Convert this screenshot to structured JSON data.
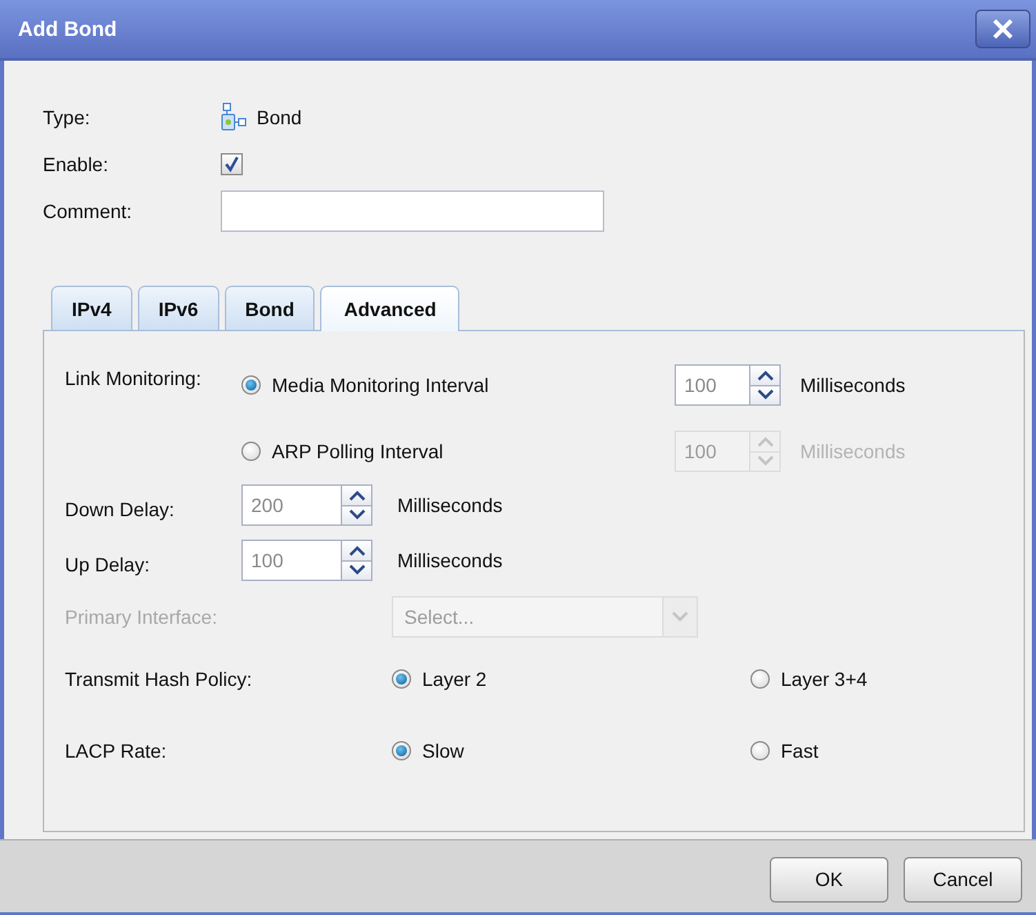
{
  "window": {
    "title": "Add Bond"
  },
  "fields": {
    "type": {
      "label": "Type:",
      "value": "Bond"
    },
    "enable": {
      "label": "Enable:",
      "checked": true
    },
    "comment": {
      "label": "Comment:"
    }
  },
  "tabs": [
    {
      "label": "IPv4",
      "selected": false
    },
    {
      "label": "IPv6",
      "selected": false
    },
    {
      "label": "Bond",
      "selected": false
    },
    {
      "label": "Advanced",
      "selected": true
    }
  ],
  "link_monitoring": {
    "label": "Link Monitoring:",
    "options": [
      {
        "label": "Media Monitoring Interval",
        "selected": true,
        "spinner": {
          "placeholder": "100",
          "disabled": false
        },
        "unit": "Milliseconds"
      },
      {
        "label": "ARP Polling Interval",
        "selected": false,
        "spinner": {
          "placeholder": "100",
          "disabled": true
        },
        "unit": "Milliseconds"
      }
    ]
  },
  "delays": [
    {
      "label": "Down Delay:",
      "placeholder": "200",
      "unit": "Milliseconds"
    },
    {
      "label": "Up Delay:",
      "placeholder": "100",
      "unit": "Milliseconds"
    }
  ],
  "primary_interface": {
    "label": "Primary Interface:",
    "placeholder": "Select...",
    "disabled": true
  },
  "choices": [
    {
      "label": "Transmit Hash Policy:",
      "options": [
        {
          "label": "Layer 2",
          "selected": true
        },
        {
          "label": "Layer 3+4",
          "selected": false
        }
      ]
    },
    {
      "label": "LACP Rate:",
      "options": [
        {
          "label": "Slow",
          "selected": true
        },
        {
          "label": "Fast",
          "selected": false
        }
      ]
    }
  ],
  "buttons": [
    "OK",
    "Cancel"
  ]
}
